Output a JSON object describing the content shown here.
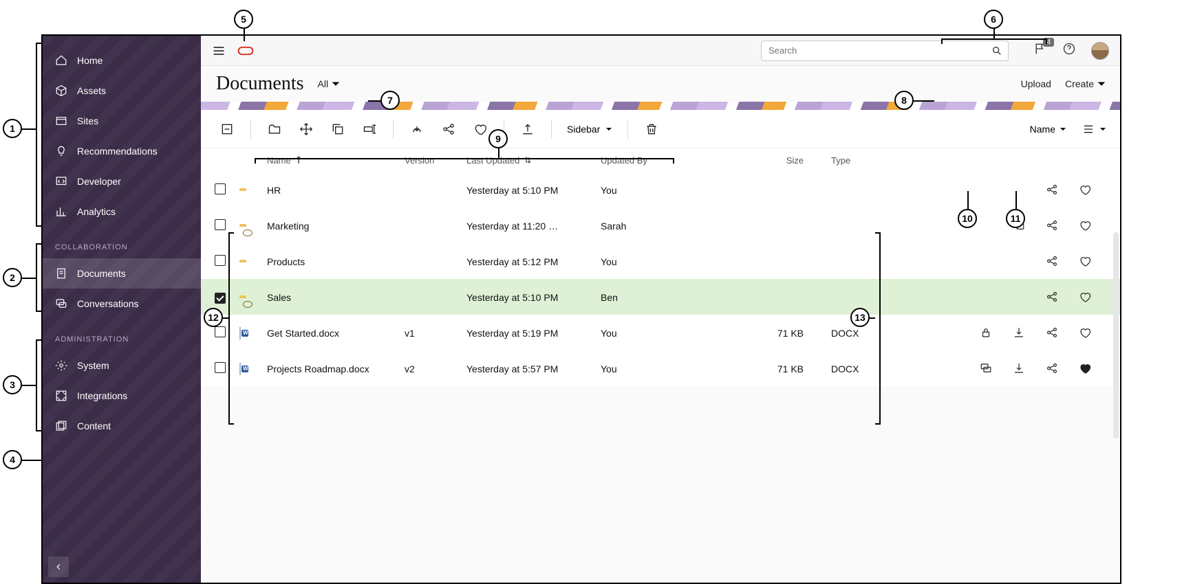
{
  "nav_top": [
    {
      "label": "Home",
      "active": false
    },
    {
      "label": "Assets",
      "active": false
    },
    {
      "label": "Sites",
      "active": false
    },
    {
      "label": "Recommendations",
      "active": false
    },
    {
      "label": "Developer",
      "active": false
    },
    {
      "label": "Analytics",
      "active": false
    }
  ],
  "section_collab": "COLLABORATION",
  "nav_collab": [
    {
      "label": "Documents",
      "active": true
    },
    {
      "label": "Conversations",
      "active": false
    }
  ],
  "section_admin": "ADMINISTRATION",
  "nav_admin": [
    {
      "label": "System",
      "active": false
    },
    {
      "label": "Integrations",
      "active": false
    },
    {
      "label": "Content",
      "active": false
    }
  ],
  "search": {
    "placeholder": "Search"
  },
  "notif_count": "4",
  "page_title": "Documents",
  "filter_label": "All",
  "upload_label": "Upload",
  "create_label": "Create",
  "sidebar_dd": "Sidebar",
  "sort_label": "Name",
  "cols": {
    "name": "Name",
    "version": "Version",
    "updated": "Last Updated",
    "by": "Updated By",
    "size": "Size",
    "type": "Type"
  },
  "rows": [
    {
      "icon": "folder",
      "name": "HR",
      "ver": "",
      "updated": "Yesterday at 5:10 PM",
      "by": "You",
      "size": "",
      "type": "",
      "selected": false,
      "actions": [
        "share",
        "fav"
      ],
      "fav": false
    },
    {
      "icon": "folder-shared",
      "name": "Marketing",
      "ver": "",
      "updated": "Yesterday at 11:20 …",
      "by": "Sarah",
      "size": "",
      "type": "",
      "selected": false,
      "actions": [
        "conv",
        "share",
        "fav"
      ],
      "fav": false
    },
    {
      "icon": "folder",
      "name": "Products",
      "ver": "",
      "updated": "Yesterday at 5:12 PM",
      "by": "You",
      "size": "",
      "type": "",
      "selected": false,
      "actions": [
        "share",
        "fav"
      ],
      "fav": false
    },
    {
      "icon": "folder-shared",
      "name": "Sales",
      "ver": "",
      "updated": "Yesterday at 5:10 PM",
      "by": "Ben",
      "size": "",
      "type": "",
      "selected": true,
      "actions": [
        "share",
        "fav"
      ],
      "fav": false
    },
    {
      "icon": "doc",
      "name": "Get Started.docx",
      "ver": "v1",
      "updated": "Yesterday at 5:19 PM",
      "by": "You",
      "size": "71 KB",
      "type": "DOCX",
      "selected": false,
      "actions": [
        "lock",
        "download",
        "share",
        "fav"
      ],
      "fav": false
    },
    {
      "icon": "doc",
      "name": "Projects Roadmap.docx",
      "ver": "v2",
      "updated": "Yesterday at 5:57 PM",
      "by": "You",
      "size": "71 KB",
      "type": "DOCX",
      "selected": false,
      "actions": [
        "conv",
        "download",
        "share",
        "fav"
      ],
      "fav": true
    }
  ],
  "callouts": [
    "1",
    "2",
    "3",
    "4",
    "5",
    "6",
    "7",
    "8",
    "9",
    "10",
    "11",
    "12",
    "13"
  ]
}
